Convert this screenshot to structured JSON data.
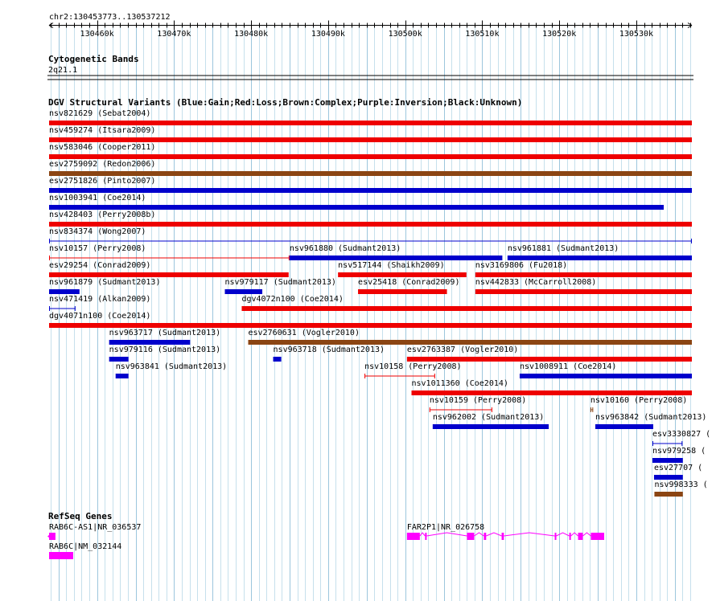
{
  "header": {
    "location": "chr2:130453773..130537212"
  },
  "ruler": {
    "start": 130453773,
    "end": 130537212,
    "ticks": [
      {
        "pos": 130460000,
        "label": "130460k"
      },
      {
        "pos": 130470000,
        "label": "130470k"
      },
      {
        "pos": 130480000,
        "label": "130480k"
      },
      {
        "pos": 130490000,
        "label": "130490k"
      },
      {
        "pos": 130500000,
        "label": "130500k"
      },
      {
        "pos": 130510000,
        "label": "130510k"
      },
      {
        "pos": 130520000,
        "label": "130520k"
      },
      {
        "pos": 130530000,
        "label": "130530k"
      }
    ]
  },
  "colors": {
    "Gain": "#0000cc",
    "Loss": "#ee0000",
    "Complex": "#8b4513",
    "Inversion": "#800080",
    "Unknown": "#000000",
    "gene": "#ff00ff",
    "grid": "#add8e6"
  },
  "tracks": {
    "cytoband": {
      "title": "Cytogenetic Bands",
      "band": "2q21.1"
    },
    "dgv": {
      "title": "DGV Structural Variants (Blue:Gain;Red:Loss;Brown:Complex;Purple:Inversion;Black:Unknown)",
      "features": [
        {
          "label": "nsv821629 (Sebat2004)",
          "type": "Loss",
          "style": "bar",
          "row": 0,
          "s": 130453773,
          "e": 130537212
        },
        {
          "label": "nsv459274 (Itsara2009)",
          "type": "Loss",
          "style": "bar",
          "row": 1,
          "s": 130453773,
          "e": 130537212
        },
        {
          "label": "nsv583046 (Cooper2011)",
          "type": "Loss",
          "style": "bar",
          "row": 2,
          "s": 130453773,
          "e": 130537212
        },
        {
          "label": "esv2759092 (Redon2006)",
          "type": "Complex",
          "style": "bar",
          "row": 3,
          "s": 130453773,
          "e": 130537212
        },
        {
          "label": "esv2751826 (Pinto2007)",
          "type": "Gain",
          "style": "bar",
          "row": 4,
          "s": 130453773,
          "e": 130537212
        },
        {
          "label": "nsv1003941 (Coe2014)",
          "type": "Gain",
          "style": "bar",
          "row": 5,
          "s": 130453773,
          "e": 130533560
        },
        {
          "label": "nsv428403 (Perry2008b)",
          "type": "Loss",
          "style": "bar",
          "row": 6,
          "s": 130453773,
          "e": 130537212
        },
        {
          "label": "nsv834374 (Wong2007)",
          "type": "Gain",
          "style": "line",
          "row": 7,
          "s": 130453773,
          "e": 130537212
        },
        {
          "label": "nsv10157 (Perry2008)",
          "type": "Loss",
          "style": "line",
          "row": 8,
          "s": 130453773,
          "e": 130484980
        },
        {
          "label": "nsv961880 (Sudmant2013)",
          "type": "Gain",
          "style": "bar",
          "row": 8,
          "s": 130484980,
          "e": 130512610
        },
        {
          "label": "nsv961881 (Sudmant2013)",
          "type": "Gain",
          "style": "bar",
          "row": 8,
          "s": 130513280,
          "e": 130537212
        },
        {
          "label": "esv29254 (Conrad2009)",
          "type": "Loss",
          "style": "bar",
          "row": 9,
          "s": 130453773,
          "e": 130484870
        },
        {
          "label": "nsv517144 (Shaikh2009)",
          "type": "Loss",
          "style": "bar",
          "row": 9,
          "s": 130491280,
          "e": 130507950
        },
        {
          "label": "nsv3169806 (Fu2018)",
          "type": "Loss",
          "style": "bar",
          "row": 9,
          "s": 130509100,
          "e": 130537212
        },
        {
          "label": "nsv961879 (Sudmant2013)",
          "type": "Gain",
          "style": "bar",
          "row": 10,
          "s": 130453773,
          "e": 130457720
        },
        {
          "label": "nsv979117 (Sudmant2013)",
          "type": "Gain",
          "style": "bar",
          "row": 10,
          "s": 130476590,
          "e": 130481450
        },
        {
          "label": "esv25418 (Conrad2009)",
          "type": "Loss",
          "style": "bar",
          "row": 10,
          "s": 130493880,
          "e": 130505420
        },
        {
          "label": "nsv442833 (McCarroll2008)",
          "type": "Loss",
          "style": "bar",
          "row": 10,
          "s": 130509100,
          "e": 130537212
        },
        {
          "label": "nsv471419 (Alkan2009)",
          "type": "Gain",
          "style": "line",
          "row": 11,
          "s": 130453773,
          "e": 130457200
        },
        {
          "label": "dgv4072n100 (Coe2014)",
          "type": "Loss",
          "style": "bar",
          "row": 11,
          "s": 130478780,
          "e": 130537212
        },
        {
          "label": "dgv4071n100 (Coe2014)",
          "type": "Loss",
          "style": "bar",
          "row": 12,
          "s": 130453773,
          "e": 130537212
        },
        {
          "label": "nsv963717 (Sudmant2013)",
          "type": "Gain",
          "style": "bar",
          "row": 13,
          "s": 130461570,
          "e": 130472080
        },
        {
          "label": "esv2760631 (Vogler2010)",
          "type": "Complex",
          "style": "bar",
          "row": 13,
          "s": 130479620,
          "e": 130537212
        },
        {
          "label": "nsv979116 (Sudmant2013)",
          "type": "Gain",
          "style": "bar",
          "row": 14,
          "s": 130461570,
          "e": 130464080
        },
        {
          "label": "nsv963718 (Sudmant2013)",
          "type": "Gain",
          "style": "bar",
          "row": 14,
          "s": 130482860,
          "e": 130483910
        },
        {
          "label": "esv2763387 (Vogler2010)",
          "type": "Loss",
          "style": "bar",
          "row": 14,
          "s": 130500230,
          "e": 130537212
        },
        {
          "label": "nsv963841 (Sudmant2013)",
          "type": "Gain",
          "style": "bar",
          "row": 15,
          "s": 130462410,
          "e": 130464080
        },
        {
          "label": "nsv10158 (Perry2008)",
          "type": "Loss",
          "style": "line",
          "row": 15,
          "s": 130494720,
          "e": 130503880
        },
        {
          "label": "nsv1008911 (Coe2014)",
          "type": "Gain",
          "style": "bar",
          "row": 15,
          "s": 130514860,
          "e": 130537212
        },
        {
          "label": "nsv1011360 (Coe2014)",
          "type": "Loss",
          "style": "bar",
          "row": 16,
          "s": 130500820,
          "e": 130537212
        },
        {
          "label": "nsv10159 (Perry2008)",
          "type": "Loss",
          "style": "line",
          "row": 17,
          "s": 130503150,
          "e": 130511300
        },
        {
          "label": "nsv10160 (Perry2008)",
          "type": "Complex",
          "style": "line",
          "row": 17,
          "s": 130524040,
          "e": 130524400
        },
        {
          "label": "nsv962002 (Sudmant2013)",
          "type": "Gain",
          "style": "bar",
          "row": 18,
          "s": 130503570,
          "e": 130518630
        },
        {
          "label": "nsv963842 (Sudmant2013)",
          "type": "Gain",
          "style": "bar",
          "row": 18,
          "s": 130524680,
          "e": 130532200
        },
        {
          "label": "esv3330827 (",
          "type": "Gain",
          "style": "line",
          "row": 19,
          "s": 130532090,
          "e": 130535990
        },
        {
          "label": "nsv979258 (",
          "type": "Gain",
          "style": "bar",
          "row": 20,
          "s": 130532090,
          "e": 130536040
        },
        {
          "label": "esv27707 (",
          "type": "Gain",
          "style": "bar",
          "row": 21,
          "s": 130532300,
          "e": 130536040
        },
        {
          "label": "nsv998333 (",
          "type": "Complex",
          "style": "bar",
          "row": 22,
          "s": 130532350,
          "e": 130536040
        }
      ]
    },
    "refseq": {
      "title": "RefSeq Genes",
      "genes": [
        {
          "label": "RAB6C-AS1|NR_036537",
          "strand": "-",
          "row": 0,
          "s": 130453773,
          "e": 130454600,
          "exons": [
            [
              130453773,
              130454600
            ]
          ]
        },
        {
          "label": "FAR2P1|NR_026758",
          "strand": "+",
          "row": 0,
          "s": 130500230,
          "e": 130525830,
          "exons": [
            [
              130500230,
              130501900
            ],
            [
              130502580,
              130502790
            ],
            [
              130508020,
              130508960
            ],
            [
              130510210,
              130510510
            ],
            [
              130512520,
              130512810
            ],
            [
              130519410,
              130519610
            ],
            [
              130521300,
              130521510
            ],
            [
              130522440,
              130523060
            ],
            [
              130524100,
              130525830
            ]
          ]
        },
        {
          "label": "RAB6C|NM_032144",
          "strand": "+",
          "row": 1,
          "s": 130453773,
          "e": 130456900,
          "exons": [
            [
              130453773,
              130456900
            ]
          ]
        }
      ]
    }
  }
}
